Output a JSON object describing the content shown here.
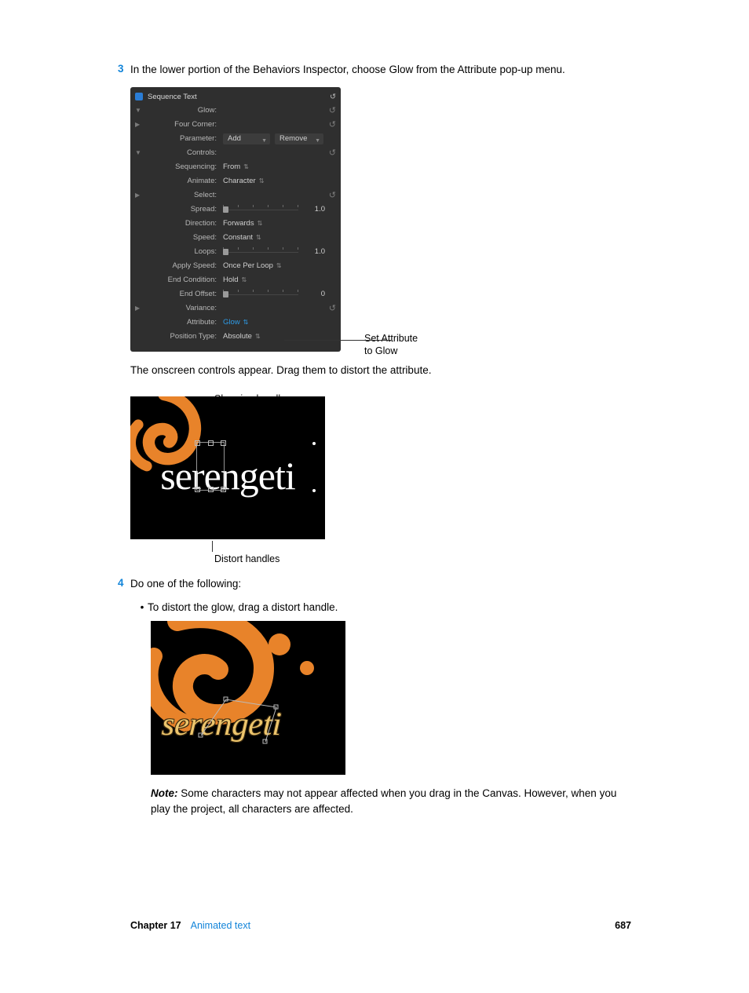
{
  "steps": {
    "three": {
      "num": "3",
      "text": "In the lower portion of the Behaviors Inspector, choose Glow from the Attribute pop-up menu."
    },
    "four": {
      "num": "4",
      "text": "Do one of the following:"
    }
  },
  "panel": {
    "title": "Sequence Text",
    "rows": {
      "glow": "Glow:",
      "fourcorner": "Four Corner:",
      "parameter": "Parameter:",
      "parameter_add": "Add",
      "parameter_remove": "Remove",
      "controls": "Controls:",
      "sequencing": "Sequencing:",
      "sequencing_val": "From",
      "animate": "Animate:",
      "animate_val": "Character",
      "select": "Select:",
      "spread": "Spread:",
      "spread_val": "1.0",
      "direction": "Direction:",
      "direction_val": "Forwards",
      "speed": "Speed:",
      "speed_val": "Constant",
      "loops": "Loops:",
      "loops_val": "1.0",
      "applyspeed": "Apply Speed:",
      "applyspeed_val": "Once Per Loop",
      "endcond": "End Condition:",
      "endcond_val": "Hold",
      "endoffset": "End Offset:",
      "endoffset_val": "0",
      "variance": "Variance:",
      "attribute": "Attribute:",
      "attribute_val": "Glow",
      "postype": "Position Type:",
      "postype_val": "Absolute"
    }
  },
  "annot": {
    "line1": "Set Attribute",
    "line2": "to Glow"
  },
  "para_onscreen": "The onscreen controls appear. Drag them to distort the attribute.",
  "fig1": {
    "top_label": "Shearing handles",
    "canvas_text": "serengeti",
    "bottom_label": "Distort handles"
  },
  "bullets": {
    "distort": "To distort the glow, drag a distort handle."
  },
  "fig2": {
    "canvas_text": "serengeti"
  },
  "note": {
    "label": "Note:",
    "text": "Some characters may not appear affected when you drag in the Canvas. However, when you play the project, all characters are affected."
  },
  "footer": {
    "chapter": "Chapter 17",
    "section": "Animated text",
    "page": "687"
  }
}
